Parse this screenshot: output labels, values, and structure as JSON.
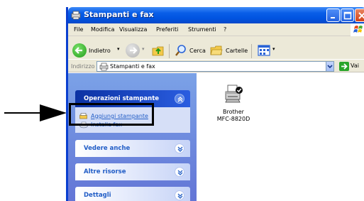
{
  "window": {
    "title": "Stampanti e fax"
  },
  "menubar": {
    "items": [
      "File",
      "Modifica",
      "Visualizza",
      "Preferiti",
      "Strumenti",
      "?"
    ]
  },
  "toolbar": {
    "back_label": "Indietro",
    "search_label": "Cerca",
    "folders_label": "Cartelle"
  },
  "address": {
    "label": "Indirizzo",
    "value": "Stampanti e fax",
    "go_label": "Vai"
  },
  "taskpane": {
    "groups": [
      {
        "title": "Operazioni stampante",
        "expanded": true,
        "tasks": [
          "Aggiungi stampante",
          "Installa fax"
        ]
      },
      {
        "title": "Vedere anche",
        "expanded": false
      },
      {
        "title": "Altre risorse",
        "expanded": false
      },
      {
        "title": "Dettagli",
        "expanded": false
      }
    ]
  },
  "content": {
    "printers": [
      {
        "name_line1": "Brother",
        "name_line2": "MFC-8820D",
        "default": true
      }
    ]
  },
  "colors": {
    "titlebar": "#0053e0",
    "taskpane": "#6f8ad9",
    "link": "#215dc6",
    "highlight_border": "#000000"
  }
}
